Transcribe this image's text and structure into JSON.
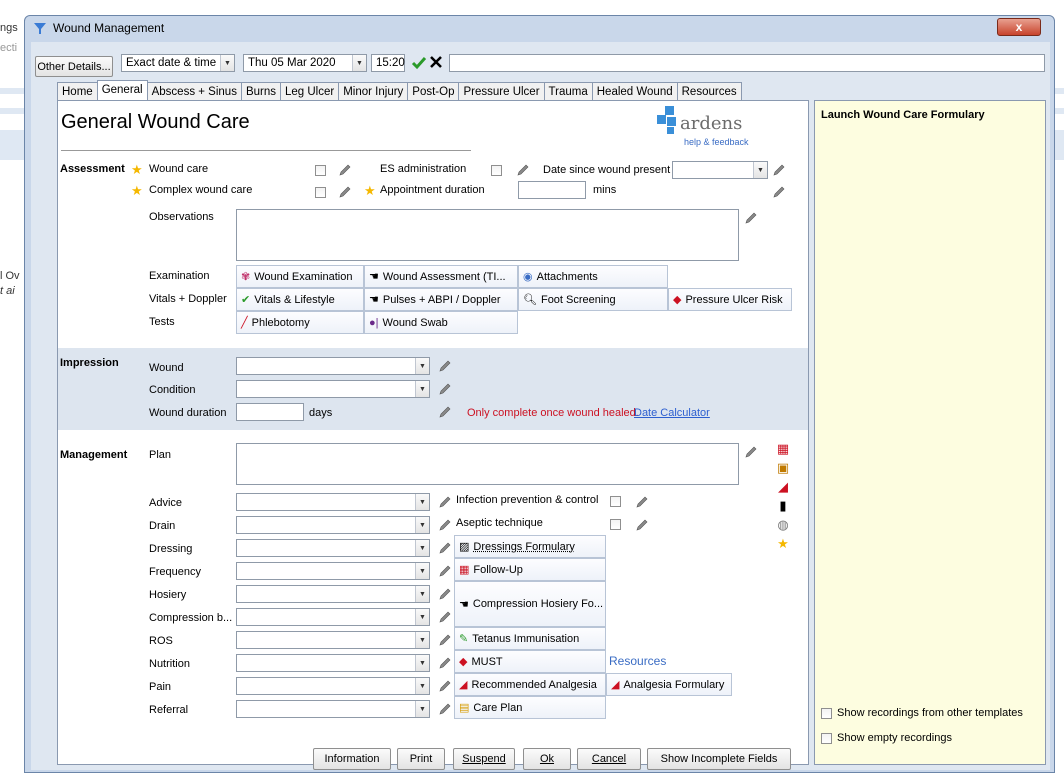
{
  "background": {
    "left_text": [
      "ngs",
      "ecti",
      "l Ov",
      "t ai"
    ]
  },
  "window": {
    "title": "Wound Management",
    "close_label": "x"
  },
  "toolbar": {
    "other_details": "Other Details...",
    "date_mode": "Exact date & time",
    "date": "Thu 05 Mar 2020",
    "time": "15:20"
  },
  "tabs": [
    "Home",
    "General",
    "Abscess + Sinus",
    "Burns",
    "Leg Ulcer",
    "Minor Injury",
    "Post-Op",
    "Pressure Ulcer",
    "Trauma",
    "Healed Wound",
    "Resources"
  ],
  "form": {
    "title": "General Wound Care",
    "brand": "ardens",
    "brand_sub": "help & feedback",
    "assessment": {
      "heading": "Assessment",
      "wound_care": "Wound care",
      "complex_wound_care": "Complex wound care",
      "es_admin": "ES administration",
      "appointment_duration": "Appointment duration",
      "mins": "mins",
      "date_since": "Date since wound present",
      "observations": "Observations",
      "examination": "Examination",
      "vitals_doppler": "Vitals + Doppler",
      "tests": "Tests",
      "btn_wound_exam": "Wound Examination",
      "btn_wound_assess": "Wound Assessment (TI...",
      "btn_attachments": "Attachments",
      "btn_vitals": "Vitals & Lifestyle",
      "btn_pulses": "Pulses + ABPI / Doppler",
      "btn_foot": "Foot Screening",
      "btn_pressure_risk": "Pressure Ulcer Risk",
      "btn_phlebotomy": "Phlebotomy",
      "btn_wound_swab": "Wound Swab"
    },
    "impression": {
      "heading": "Impression",
      "wound": "Wound",
      "condition": "Condition",
      "wound_duration": "Wound duration",
      "days": "days",
      "note": "Only complete once wound healed.",
      "date_calc": "Date Calculator"
    },
    "management": {
      "heading": "Management",
      "plan": "Plan",
      "advice": "Advice",
      "drain": "Drain",
      "dressing": "Dressing",
      "frequency": "Frequency",
      "hosiery": "Hosiery",
      "compression": "Compression b...",
      "ros": "ROS",
      "nutrition": "Nutrition",
      "pain": "Pain",
      "referral": "Referral",
      "infection_prev": "Infection prevention & control",
      "aseptic": "Aseptic technique",
      "btn_dressings_formulary": "Dressings Formulary",
      "btn_follow_up": "Follow-Up",
      "btn_compression_hosiery": "Compression Hosiery Fo...",
      "btn_tetanus": "Tetanus Immunisation",
      "btn_must": "MUST",
      "resources": "Resources",
      "btn_recommended_analgesia": "Recommended Analgesia",
      "btn_analgesia_formulary": "Analgesia Formulary",
      "btn_care_plan": "Care Plan"
    }
  },
  "side": {
    "title": "Launch Wound Care Formulary",
    "show_other": "Show recordings from other templates",
    "show_empty": "Show empty recordings"
  },
  "footer": {
    "information": "Information",
    "print": "Print",
    "suspend": "Suspend",
    "ok": "Ok",
    "cancel": "Cancel",
    "show_incomplete": "Show Incomplete Fields"
  },
  "colors": {
    "window_frame": "#c9d7ea",
    "panel_bg": "#dfe7f1",
    "side_bg": "#fdfde0",
    "shaded_section": "#dde5ef",
    "close_red": "#c8442c",
    "star": "#f5b800"
  }
}
